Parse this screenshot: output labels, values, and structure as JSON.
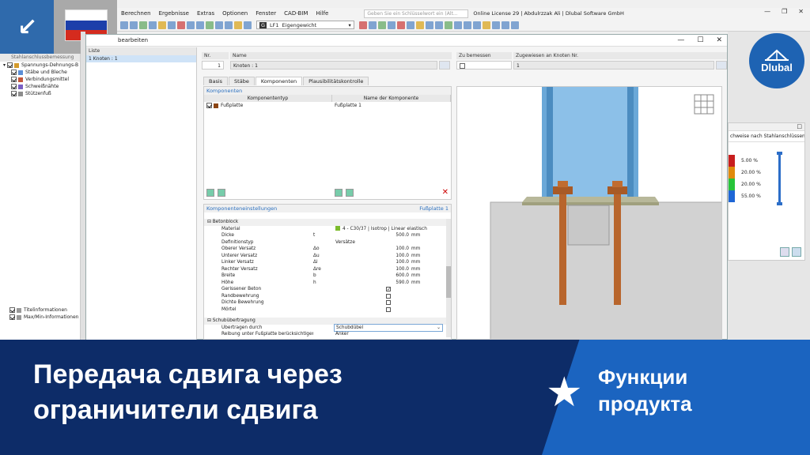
{
  "menubar": {
    "items": [
      "Berechnen",
      "Ergebnisse",
      "Extras",
      "Optionen",
      "Fenster",
      "CAD-BIM",
      "Hilfe"
    ],
    "search_placeholder": "Geben Sie ein Schlüsselwort ein (Alt...",
    "license": "Online License 29 | Abdulrzzak Ali | Dlubal Software GmbH"
  },
  "toolbar": {
    "lc_badge": "G",
    "lc_id": "LF1",
    "lc_name": "Eigengewicht"
  },
  "navigator": {
    "header": "Stahlanschlussbemessung",
    "items": [
      {
        "label": "Spannungs-Dehnungs-B",
        "checked": true,
        "color": "#d49b2c",
        "level": 0
      },
      {
        "label": "Stäbe und Bleche",
        "checked": true,
        "color": "#5b8ed6",
        "level": 1
      },
      {
        "label": "Verbindungsmittel",
        "checked": true,
        "color": "#c4563a",
        "level": 1
      },
      {
        "label": "Schweißnähte",
        "checked": true,
        "color": "#7a5fc4",
        "level": 1
      },
      {
        "label": "Stützenfuß",
        "checked": true,
        "color": "#8c8c8c",
        "level": 1
      }
    ],
    "bottom_items": [
      {
        "label": "Titelinformationen",
        "checked": true
      },
      {
        "label": "Max/Min-Informationen",
        "checked": true
      }
    ]
  },
  "dialog": {
    "title": "bearbeiten",
    "liste_header": "Liste",
    "liste_item": "1  Knoten : 1",
    "fields": {
      "nr_label": "Nr.",
      "nr_value": "1",
      "name_label": "Name",
      "name_value": "Knoten : 1",
      "zu_label": "Zu bemessen",
      "zugewiesen_label": "Zugewiesen an Knoten Nr.",
      "zugewiesen_value": "1"
    },
    "tabs": [
      "Basis",
      "Stäbe",
      "Komponenten",
      "Plausibilitätskontrolle"
    ],
    "active_tab": "Komponenten",
    "komponenten": {
      "title": "Komponenten",
      "col1": "Komponententyp",
      "col2": "Name der Komponente",
      "rows": [
        {
          "type": "Fußplatte",
          "name": "Fußplatte 1",
          "color": "#8b4513"
        }
      ]
    },
    "einstellungen": {
      "title": "Komponenteneinstellungen",
      "subtitle": "Fußplatte 1",
      "rows": [
        {
          "label": "Betonblock",
          "group": true
        },
        {
          "label": "Material",
          "sym": "",
          "value": "4 - C30/37 | Isotrop | Linear elastisch",
          "unit": "",
          "material": true
        },
        {
          "label": "Dicke",
          "sym": "t",
          "value": "500.0",
          "unit": "mm"
        },
        {
          "label": "Definitionstyp",
          "sym": "",
          "value": "Versätze",
          "unit": "",
          "left": true
        },
        {
          "label": "Oberer Versatz",
          "sym": "Δo",
          "value": "100.0",
          "unit": "mm"
        },
        {
          "label": "Unterer Versatz",
          "sym": "Δu",
          "value": "100.0",
          "unit": "mm"
        },
        {
          "label": "Linker Versatz",
          "sym": "Δl",
          "value": "100.0",
          "unit": "mm"
        },
        {
          "label": "Rechter Versatz",
          "sym": "Δre",
          "value": "100.0",
          "unit": "mm"
        },
        {
          "label": "Breite",
          "sym": "b",
          "value": "600.0",
          "unit": "mm"
        },
        {
          "label": "Höhe",
          "sym": "h",
          "value": "590.0",
          "unit": "mm"
        },
        {
          "label": "Gerissener Beton",
          "checkbox": true,
          "checked": true
        },
        {
          "label": "Randbewehrung",
          "checkbox": true,
          "checked": false
        },
        {
          "label": "Dichte Bewehrung",
          "checkbox": true,
          "checked": false
        },
        {
          "label": "Mörtel",
          "checkbox": true,
          "checked": false
        },
        {
          "label": "",
          "spacer": true
        },
        {
          "label": "Schubübertragung",
          "group": true
        },
        {
          "label": "Übertragen durch",
          "select": true,
          "value": "Schubdübel"
        },
        {
          "label": "Reibung unter Fußplatte berücksichtigen",
          "value": "Anker",
          "left": true
        }
      ]
    }
  },
  "result_panel": {
    "header": "chweise nach Stahlanschlüssen",
    "legend": [
      {
        "color": "#c81e1e",
        "value": "5.00 %"
      },
      {
        "color": "#e08a0c",
        "value": "20.00 %"
      },
      {
        "color": "#27c43a",
        "value": "20.00 %"
      },
      {
        "color": "#1e66d6",
        "value": "55.00 %"
      }
    ]
  },
  "logo": {
    "text": "Dlubal"
  },
  "banner": {
    "headline_line1": "Передача сдвига через",
    "headline_line2": "ограничители сдвига",
    "sub_line1": "Функции",
    "sub_line2": "продукта"
  }
}
